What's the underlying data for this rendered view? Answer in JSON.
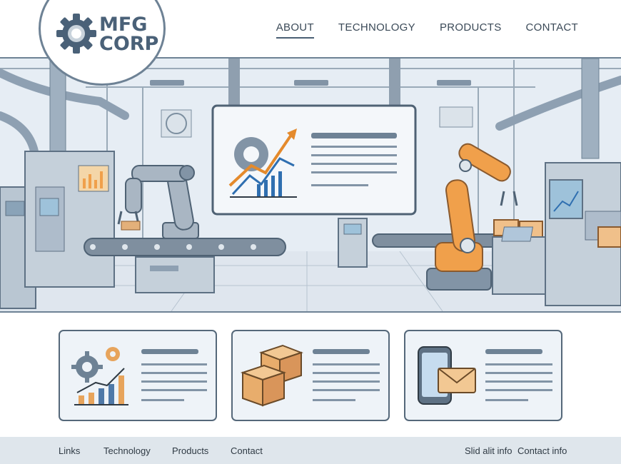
{
  "logo": {
    "line1": "MFG",
    "line2": "CORP"
  },
  "nav": {
    "items": [
      "ABOUT",
      "TECHNOLOGY",
      "PRODUCTS",
      "CONTACT"
    ],
    "active": "ABOUT"
  },
  "footer": {
    "left_links": [
      "Links",
      "Technology",
      "Products",
      "Contact"
    ],
    "right_links": [
      "Slid alit info",
      "Contact info"
    ]
  },
  "colors": {
    "accent_orange": "#f0a04b",
    "dark_blue": "#4a6178",
    "line": "#55687a",
    "footer_bg": "#dfe6ec"
  },
  "icons": {
    "logo": "gear-icon",
    "hero_screen": "gear-growth-chart-icon",
    "card_1": "gears-bar-chart-icon",
    "card_2": "boxes-icon",
    "card_3": "phone-mail-icon"
  }
}
